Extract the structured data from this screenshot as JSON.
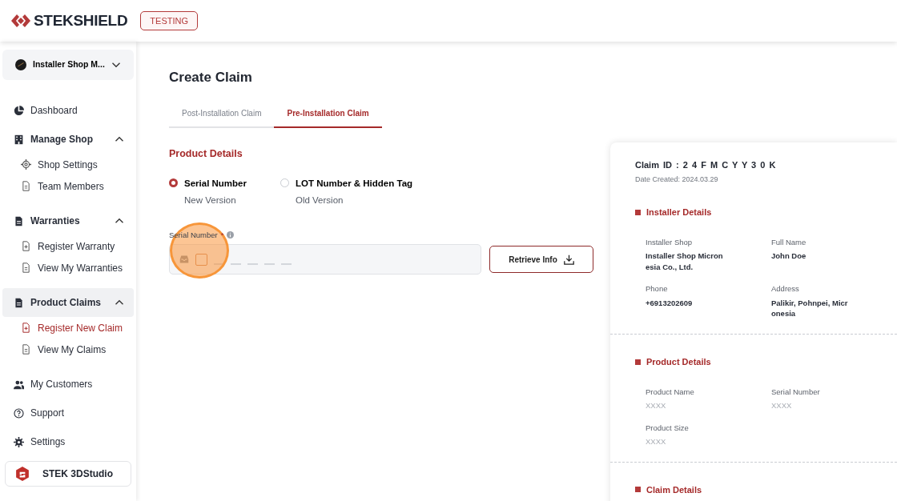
{
  "header": {
    "logo_text": "STEKSHIELD",
    "env_badge": "TESTING"
  },
  "sidebar": {
    "shop_selector": {
      "label": "Installer Shop M..."
    },
    "items": [
      {
        "kind": "link",
        "label": "Dashboard",
        "selected": false
      },
      {
        "kind": "group",
        "label": "Manage Shop",
        "expanded": true,
        "active": false,
        "children": [
          {
            "label": "Shop Settings",
            "selected": false
          },
          {
            "label": "Team Members",
            "selected": false
          }
        ]
      },
      {
        "kind": "group",
        "label": "Warranties",
        "expanded": true,
        "active": false,
        "children": [
          {
            "label": "Register Warranty",
            "selected": false
          },
          {
            "label": "View My Warranties",
            "selected": false
          }
        ]
      },
      {
        "kind": "group",
        "label": "Product Claims",
        "expanded": true,
        "active": true,
        "children": [
          {
            "label": "Register New Claim",
            "selected": true
          },
          {
            "label": "View My Claims",
            "selected": false
          }
        ]
      },
      {
        "kind": "link",
        "label": "My Customers",
        "selected": false
      },
      {
        "kind": "link",
        "label": "Support",
        "selected": false
      },
      {
        "kind": "link",
        "label": "Settings",
        "selected": false
      }
    ],
    "promo": {
      "label": "STEK 3DStudio"
    }
  },
  "main": {
    "title": "Create Claim",
    "tabs": [
      {
        "label": "Post-Installation Claim",
        "selected": false
      },
      {
        "label": "Pre-Installation Claim",
        "selected": true
      }
    ],
    "section_title": "Product Details",
    "options": [
      {
        "label": "Serial Number",
        "sublabel": "New Version",
        "selected": true
      },
      {
        "label": "LOT Number & Hidden Tag",
        "sublabel": "Old Version",
        "selected": false
      }
    ],
    "serial_field": {
      "label": "Serial Number",
      "required_mark": "*"
    },
    "retrieve_button": "Retrieve Info"
  },
  "claim_panel": {
    "claim_id": "Claim ID : 2 4 F M C Y Y 3 0 K",
    "date_created": "Date Created: 2024.03.29",
    "sections": [
      {
        "title": "Installer Details",
        "fields": [
          {
            "label": "Installer Shop",
            "value": "Installer Shop Micronesia Co., Ltd.",
            "placeholder": false
          },
          {
            "label": "Full Name",
            "value": "John Doe",
            "placeholder": false
          },
          {
            "label": "Phone",
            "value": "+6913202609",
            "placeholder": false
          },
          {
            "label": "Address",
            "value": "Palikir, Pohnpei, Micronesia",
            "placeholder": false
          }
        ]
      },
      {
        "title": "Product Details",
        "fields": [
          {
            "label": "Product Name",
            "value": "XXXX",
            "placeholder": true
          },
          {
            "label": "Serial Number",
            "value": "XXXX",
            "placeholder": true
          },
          {
            "label": "Product Size",
            "value": "XXXX",
            "placeholder": true
          }
        ]
      },
      {
        "title": "Claim Details"
      }
    ]
  }
}
